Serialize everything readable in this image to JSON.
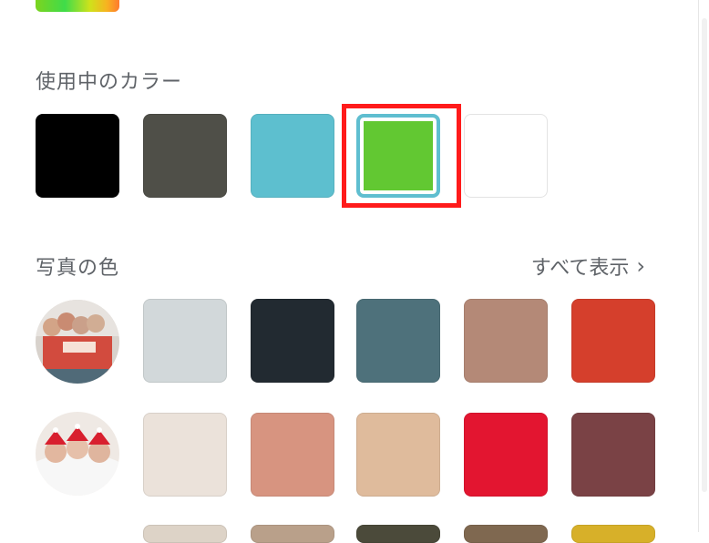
{
  "sections": {
    "in_use": {
      "title": "使用中のカラー",
      "colors": [
        "#000000",
        "#4f4f48",
        "#5dbfcf",
        "#62c832",
        "#ffffff"
      ],
      "selected_index": 3
    },
    "photo_colors": {
      "title": "写真の色",
      "see_all_label": "すべて表示",
      "see_all_icon": "chevron-right-icon",
      "rows": [
        {
          "photo_icon": "photo-thumbnail",
          "colors": [
            "#d2d8da",
            "#222a31",
            "#4e717b",
            "#b48977",
            "#d53f2c"
          ]
        },
        {
          "photo_icon": "photo-thumbnail",
          "colors": [
            "#ebe2da",
            "#d79480",
            "#dfbb9c",
            "#e31530",
            "#7a4245"
          ]
        }
      ]
    }
  },
  "top_swatch": {
    "icon": "rainbow-color-picker",
    "colors": [
      "#7cd41f",
      "#3fdc4a",
      "#cfe21b",
      "#f7b320",
      "#ff7a2e"
    ]
  },
  "highlight_color": "#ff1b1b"
}
